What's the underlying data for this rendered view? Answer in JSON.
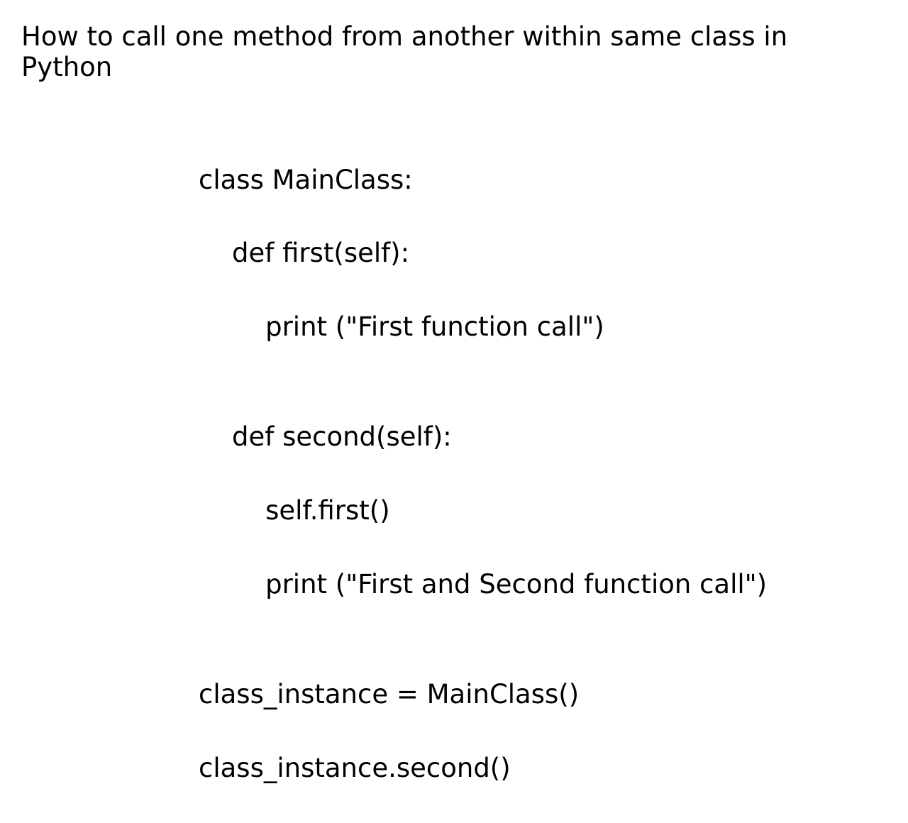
{
  "title": "How to call one method from another within same class in Python",
  "code": {
    "lines": [
      "class MainClass:",
      "    def first(self):",
      "        print (\"First function call\")",
      "",
      "    def second(self):",
      "        self.first()",
      "        print (\"First and Second function call\")",
      "",
      "class_instance = MainClass()",
      "class_instance.second()"
    ]
  }
}
